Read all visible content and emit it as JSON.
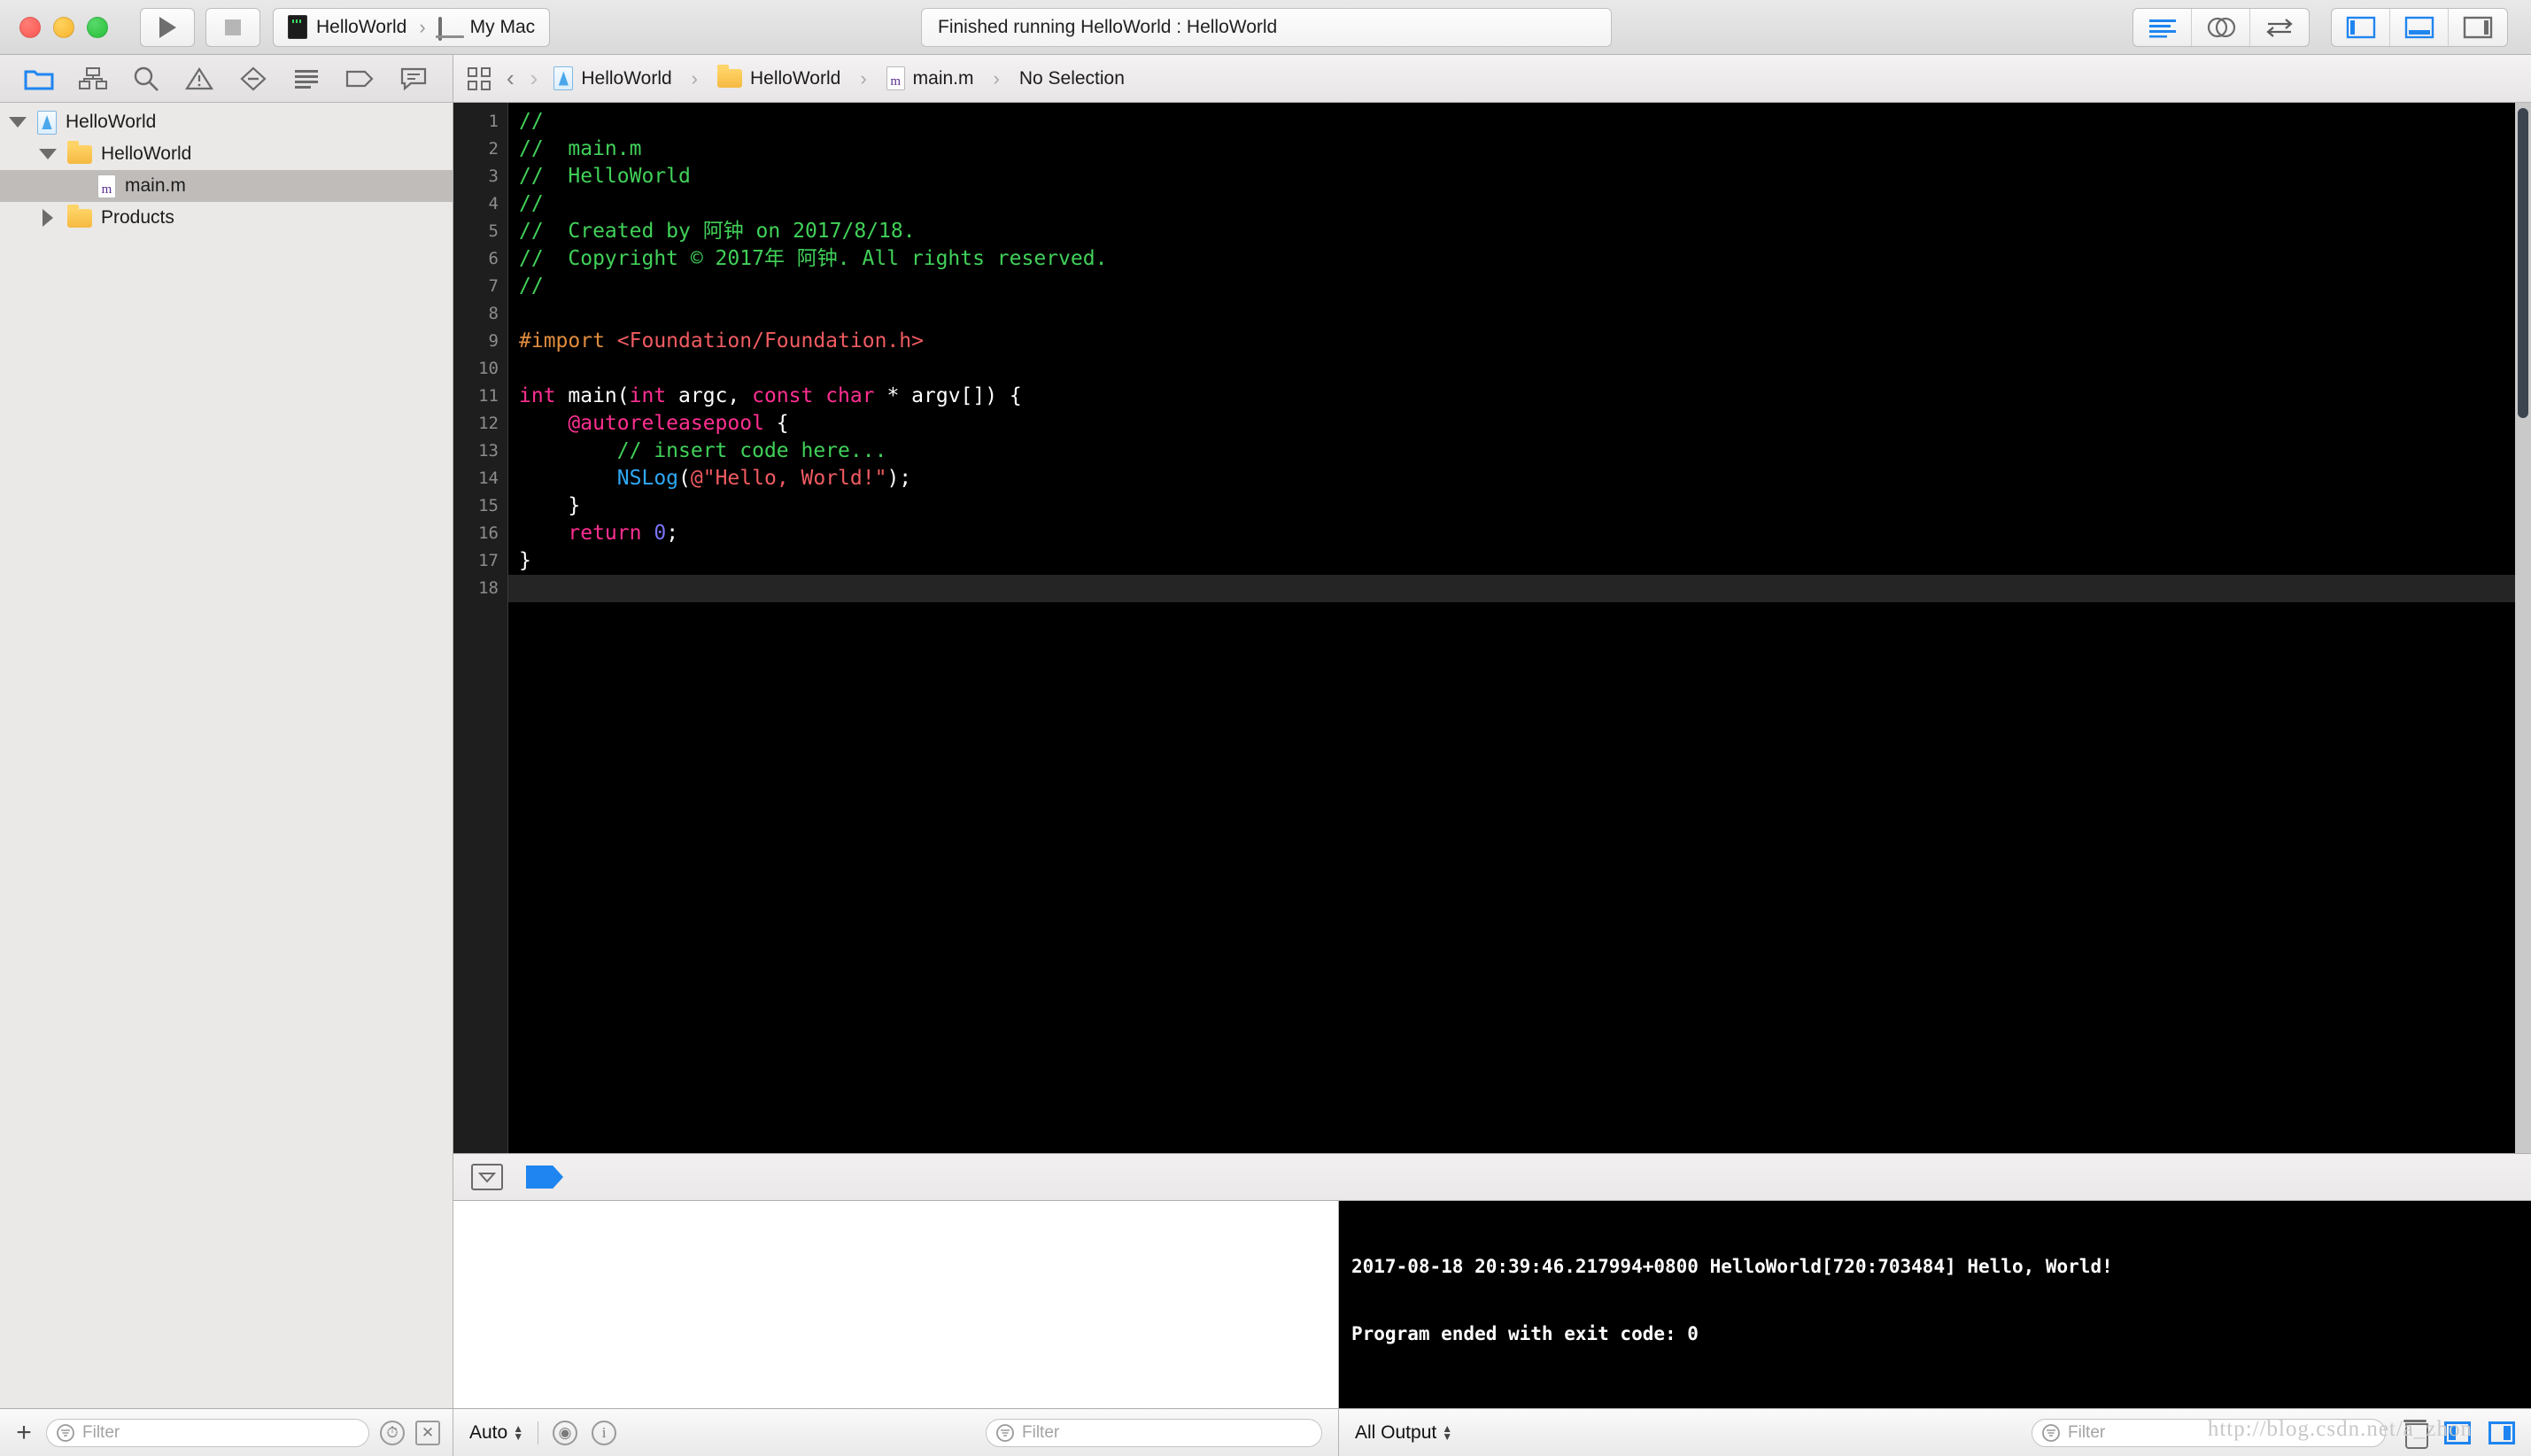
{
  "window": {
    "title": "Finished running HelloWorld : HelloWorld",
    "traffic_lights": [
      "close",
      "minimize",
      "zoom"
    ]
  },
  "toolbar": {
    "run_button": "run-icon",
    "stop_button": "stop-icon",
    "scheme": {
      "project": "HelloWorld",
      "separator": "›",
      "destination": "My Mac"
    },
    "editor_modes": [
      "standard-editor-icon",
      "assistant-editor-icon",
      "version-editor-icon"
    ],
    "panel_toggles": [
      "navigator-toggle-icon",
      "debug-area-toggle-icon",
      "utilities-toggle-icon"
    ],
    "accent_color": "#1f85f0"
  },
  "navigator": {
    "tabs": [
      "project-navigator-icon",
      "symbol-navigator-icon",
      "find-navigator-icon",
      "issue-navigator-icon",
      "test-navigator-icon",
      "debug-navigator-icon",
      "breakpoint-navigator-icon",
      "report-navigator-icon"
    ],
    "active_tab": "project-navigator-icon",
    "tree": [
      {
        "label": "HelloWorld",
        "icon": "xcode-project-icon",
        "depth": 0,
        "disclosure": "open",
        "selected": false
      },
      {
        "label": "HelloWorld",
        "icon": "folder-icon",
        "depth": 1,
        "disclosure": "open",
        "selected": false
      },
      {
        "label": "main.m",
        "icon": "objc-file-icon",
        "depth": 2,
        "disclosure": "none",
        "selected": true
      },
      {
        "label": "Products",
        "icon": "folder-icon",
        "depth": 1,
        "disclosure": "closed",
        "selected": false
      }
    ],
    "footer": {
      "add_label": "+",
      "filter_placeholder": "Filter",
      "icons": [
        "recent-files-icon",
        "source-control-filter-icon"
      ]
    }
  },
  "jump_bar": {
    "related_items_icon": "related-items-icon",
    "back_icon": "chevron-left-icon",
    "forward_icon": "chevron-right-icon",
    "crumbs": [
      {
        "label": "HelloWorld",
        "icon": "xcode-project-icon"
      },
      {
        "label": "HelloWorld",
        "icon": "folder-icon"
      },
      {
        "label": "main.m",
        "icon": "objc-file-icon"
      },
      {
        "label": "No Selection",
        "icon": "none"
      }
    ],
    "separator": "›"
  },
  "editor": {
    "filename": "main.m",
    "line_numbers": [
      1,
      2,
      3,
      4,
      5,
      6,
      7,
      8,
      9,
      10,
      11,
      12,
      13,
      14,
      15,
      16,
      17,
      18
    ],
    "current_line": 18,
    "theme": {
      "background": "#000000",
      "gutter_background": "#1e1e1e",
      "comment": "#41d159",
      "preprocessor": "#e08c3e",
      "header": "#f05b62",
      "keyword": "#ff2f92",
      "function": "#2fa8f5",
      "string": "#f05b62",
      "number": "#7a72f7",
      "plain": "#ffffff"
    },
    "lines": [
      [
        {
          "t": "//",
          "c": "cm"
        }
      ],
      [
        {
          "t": "//  main.m",
          "c": "cm"
        }
      ],
      [
        {
          "t": "//  HelloWorld",
          "c": "cm"
        }
      ],
      [
        {
          "t": "//",
          "c": "cm"
        }
      ],
      [
        {
          "t": "//  Created by 阿钟 on 2017/8/18.",
          "c": "cm"
        }
      ],
      [
        {
          "t": "//  Copyright © 2017年 阿钟. All rights reserved.",
          "c": "cm"
        }
      ],
      [
        {
          "t": "//",
          "c": "cm"
        }
      ],
      [
        {
          "t": "",
          "c": "pl"
        }
      ],
      [
        {
          "t": "#import ",
          "c": "pre"
        },
        {
          "t": "<Foundation/Foundation.h>",
          "c": "hdr"
        }
      ],
      [
        {
          "t": "",
          "c": "pl"
        }
      ],
      [
        {
          "t": "int ",
          "c": "kw"
        },
        {
          "t": "main(",
          "c": "pl"
        },
        {
          "t": "int ",
          "c": "kw"
        },
        {
          "t": "argc, ",
          "c": "pl"
        },
        {
          "t": "const char ",
          "c": "kw"
        },
        {
          "t": "* argv[]) {",
          "c": "pl"
        }
      ],
      [
        {
          "t": "    ",
          "c": "pl"
        },
        {
          "t": "@autoreleasepool",
          "c": "kw"
        },
        {
          "t": " {",
          "c": "pl"
        }
      ],
      [
        {
          "t": "        ",
          "c": "pl"
        },
        {
          "t": "// insert code here...",
          "c": "cm"
        }
      ],
      [
        {
          "t": "        ",
          "c": "pl"
        },
        {
          "t": "NSLog",
          "c": "fn"
        },
        {
          "t": "(",
          "c": "pl"
        },
        {
          "t": "@\"Hello, World!\"",
          "c": "str"
        },
        {
          "t": ");",
          "c": "pl"
        }
      ],
      [
        {
          "t": "    }",
          "c": "pl"
        }
      ],
      [
        {
          "t": "    ",
          "c": "pl"
        },
        {
          "t": "return ",
          "c": "kw"
        },
        {
          "t": "0",
          "c": "num"
        },
        {
          "t": ";",
          "c": "pl"
        }
      ],
      [
        {
          "t": "}",
          "c": "pl"
        }
      ],
      [
        {
          "t": "",
          "c": "pl"
        }
      ]
    ]
  },
  "debug_bar": {
    "hide_debug_area_icon": "hide-debug-area-icon",
    "breakpoints_icon": "breakpoint-toggle-icon",
    "breakpoints_active": true
  },
  "debug_area": {
    "variables_view": {
      "content": ""
    },
    "console": {
      "lines": [
        "2017-08-18 20:39:46.217994+0800 HelloWorld[720:703484] Hello, World!",
        "Program ended with exit code: 0"
      ]
    }
  },
  "status_bar": {
    "variables_scope": "Auto",
    "variables_icons": [
      "show-disclosure-icon",
      "info-icon"
    ],
    "variables_filter_placeholder": "Filter",
    "console_scope": "All Output",
    "console_filter_placeholder": "Filter",
    "console_icons": [
      "clear-console-icon",
      "show-variables-view-icon",
      "show-console-view-icon"
    ]
  },
  "watermark": "http://blog.csdn.net/a_zhon"
}
